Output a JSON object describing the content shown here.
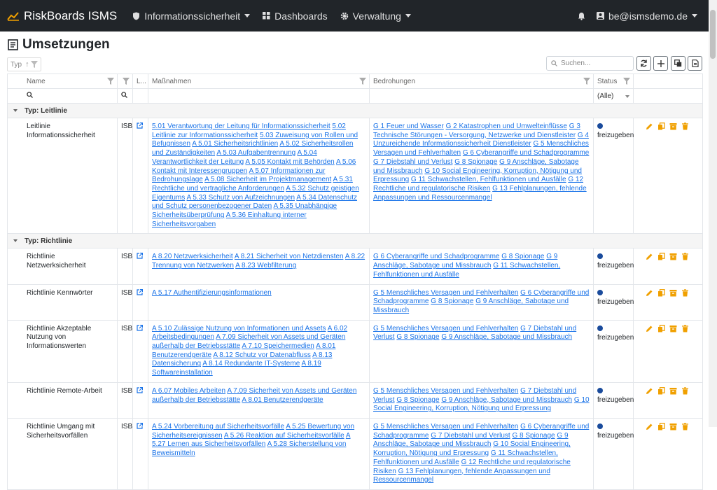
{
  "navbar": {
    "brand": "RiskBoards ISMS",
    "items": [
      "Informationssicherheit",
      "Dashboards",
      "Verwaltung"
    ],
    "user": "be@ismsdemo.de"
  },
  "page": {
    "title": "Umsetzungen"
  },
  "toolbar": {
    "typ_label": "Typ",
    "search_placeholder": "Suchen..."
  },
  "columns": {
    "name": "Name",
    "l": "L...",
    "massnahmen": "Maßnahmen",
    "bedrohungen": "Bedrohungen",
    "status": "Status",
    "status_filter": "(Alle)"
  },
  "colors": {
    "link": "#1a73e8",
    "action": "#f0a000",
    "status_dot": "#1a4b9c",
    "navbar": "#212529"
  },
  "groups": [
    {
      "label": "Typ: Leitlinie",
      "rows": [
        {
          "name": "Leitlinie Informationssicherheit",
          "owner": "ISB",
          "massnahmen": [
            "5.01 Verantwortung der Leitung für Informationssicherheit",
            "5.02 Leitlinie zur Informationssicherheit",
            "5.03 Zuweisung von Rollen und Befugnissen",
            "A 5.01 Sicherheitsrichtlinien",
            "A 5.02 Sicherheitsrollen und Zuständigkeiten",
            "A 5.03 Aufgabentrennung",
            "A 5.04 Verantwortlichkeit der Leitung",
            "A 5.05 Kontakt mit Behörden",
            "A 5.06 Kontakt mit Interessengruppen",
            "A 5.07 Informationen zur Bedrohungslage",
            "A 5.08 Sicherheit im Projektmanagement",
            "A 5.31 Rechtliche und vertragliche Anforderungen",
            "A 5.32 Schutz geistigen Eigentums",
            "A 5.33 Schutz von Aufzeichnungen",
            "A 5.34 Datenschutz und Schutz personenbezogener Daten",
            "A 5.35 Unabhängige Sicherheitsüberprüfung",
            "A 5.36 Einhaltung interner Sicherheitsvorgaben"
          ],
          "bedrohungen": [
            "G 1 Feuer und Wasser",
            "G 2 Katastrophen und Umwelteinflüsse",
            "G 3 Technische Störungen - Versorgung, Netzwerke und Dienstleister",
            "G 4 Unzureichende Informationssicherheit Dienstleister",
            "G 5 Menschliches Versagen und Fehlverhalten",
            "G 6 Cyberangriffe und Schadprogramme",
            "G 7 Diebstahl und Verlust",
            "G 8 Spionage",
            "G 9 Anschläge, Sabotage und Missbrauch",
            "G 10 Social Engineering, Korruption, Nötigung und Erpressung",
            "G 11 Schwachstellen, Fehlfunktionen und Ausfälle",
            "G 12 Rechtliche und regulatorische Risiken",
            "G 13 Fehlplanungen, fehlende Anpassungen und Ressourcenmangel"
          ],
          "status": "freizugeben"
        }
      ]
    },
    {
      "label": "Typ: Richtlinie",
      "rows": [
        {
          "name": "Richtlinie Netzwerksicherheit",
          "owner": "ISB",
          "massnahmen": [
            "A 8.20 Netzwerksicherheit",
            "A 8.21 Sicherheit von Netzdiensten",
            "A 8.22 Trennung von Netzwerken",
            "A 8.23 Webfilterung"
          ],
          "bedrohungen": [
            "G 6 Cyberangriffe und Schadprogramme",
            "G 8 Spionage",
            "G 9 Anschläge, Sabotage und Missbrauch",
            "G 11 Schwachstellen, Fehlfunktionen und Ausfälle"
          ],
          "status": "freizugeben"
        },
        {
          "name": "Richtlinie Kennwörter",
          "owner": "ISB",
          "massnahmen": [
            "A 5.17 Authentifizierungsinformationen"
          ],
          "bedrohungen": [
            "G 5 Menschliches Versagen und Fehlverhalten",
            "G 6 Cyberangriffe und Schadprogramme",
            "G 8 Spionage",
            "G 9 Anschläge, Sabotage und Missbrauch"
          ],
          "status": "freizugeben"
        },
        {
          "name": "Richtlinie Akzeptable Nutzung von Informationswerten",
          "owner": "ISB",
          "massnahmen": [
            "A 5.10 Zulässige Nutzung von Informationen und Assets",
            "A 6.02 Arbeitsbedingungen",
            "A 7.09 Sicherheit von Assets und Geräten außerhalb der Betriebsstätte",
            "A 7.10 Speichermedien",
            "A 8.01 Benutzerendgeräte",
            "A 8.12 Schutz vor Datenabfluss",
            "A 8.13 Datensicherung",
            "A 8.14 Redundante IT-Systeme",
            "A 8.19 Softwareinstallation"
          ],
          "bedrohungen": [
            "G 5 Menschliches Versagen und Fehlverhalten",
            "G 7 Diebstahl und Verlust",
            "G 8 Spionage",
            "G 9 Anschläge, Sabotage und Missbrauch"
          ],
          "status": "freizugeben"
        },
        {
          "name": "Richtlinie Remote-Arbeit",
          "owner": "ISB",
          "massnahmen": [
            "A 6.07 Mobiles Arbeiten",
            "A 7.09 Sicherheit von Assets und Geräten außerhalb der Betriebsstätte",
            "A 8.01 Benutzerendgeräte"
          ],
          "bedrohungen": [
            "G 5 Menschliches Versagen und Fehlverhalten",
            "G 7 Diebstahl und Verlust",
            "G 8 Spionage",
            "G 9 Anschläge, Sabotage und Missbrauch",
            "G 10 Social Engineering, Korruption, Nötigung und Erpressung"
          ],
          "status": "freizugeben"
        },
        {
          "name": "Richtlinie Umgang mit Sicherheitsvorfällen",
          "owner": "ISB",
          "massnahmen": [
            "A 5.24 Vorbereitung auf Sicherheitsvorfälle",
            "A 5.25 Bewertung von Sicherheitsereignissen",
            "A 5.26 Reaktion auf Sicherheitsvorfälle",
            "A 5.27 Lernen aus Sicherheitsvorfällen",
            "A 5.28 Sicherstellung von Beweismitteln"
          ],
          "bedrohungen": [
            "G 5 Menschliches Versagen und Fehlverhalten",
            "G 6 Cyberangriffe und Schadprogramme",
            "G 7 Diebstahl und Verlust",
            "G 8 Spionage",
            "G 9 Anschläge, Sabotage und Missbrauch",
            "G 10 Social Engineering, Korruption, Nötigung und Erpressung",
            "G 11 Schwachstellen, Fehlfunktionen und Ausfälle",
            "G 12 Rechtliche und regulatorische Risiken",
            "G 13 Fehlplanungen, fehlende Anpassungen und Ressourcenmangel"
          ],
          "status": "freizugeben"
        }
      ]
    }
  ]
}
